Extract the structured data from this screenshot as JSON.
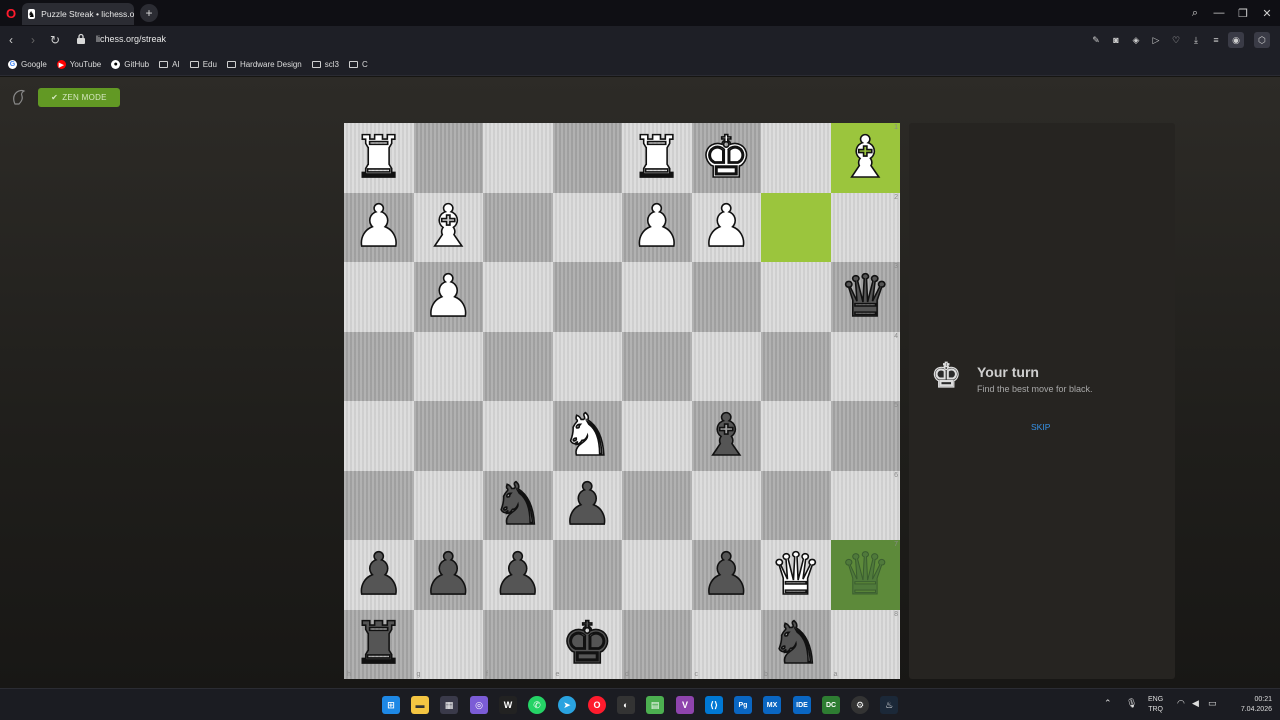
{
  "browser": {
    "tab_title": "Puzzle Streak • lichess.org",
    "url": "lichess.org/streak",
    "bookmarks": [
      "Google",
      "YouTube",
      "GitHub",
      "AI",
      "Edu",
      "Hardware Design",
      "scl3",
      "C"
    ]
  },
  "toolbar": {
    "zen_label": "ZEN MODE"
  },
  "board": {
    "rank_labels": [
      "1",
      "2",
      "3",
      "4",
      "5",
      "6",
      "7",
      "8"
    ],
    "file_labels": [
      "h",
      "g",
      "f",
      "e",
      "d",
      "c",
      "b",
      "a"
    ],
    "rows": [
      [
        "wR",
        "",
        "",
        "",
        "wR",
        "wK",
        "",
        "wB"
      ],
      [
        "wP",
        "wB",
        "",
        "",
        "wP",
        "wP",
        "",
        ""
      ],
      [
        "",
        "wP",
        "",
        "",
        "",
        "",
        "",
        "bQ"
      ],
      [
        "",
        "",
        "",
        "",
        "",
        "",
        "",
        ""
      ],
      [
        "",
        "",
        "",
        "wN",
        "",
        "bB",
        "",
        ""
      ],
      [
        "",
        "",
        "bN",
        "bP",
        "",
        "",
        "",
        ""
      ],
      [
        "bP",
        "bP",
        "bP",
        "",
        "",
        "bP",
        "wQ",
        "gQ"
      ],
      [
        "bR",
        "",
        "",
        "bK",
        "",
        "",
        "bN",
        ""
      ]
    ],
    "highlights": [
      [
        0,
        7
      ],
      [
        1,
        6
      ],
      [
        6,
        7
      ]
    ]
  },
  "panel": {
    "title": "Your turn",
    "subtitle": "Find the best move for black.",
    "skip": "SKIP"
  },
  "taskbar": {
    "lang_top": "ENG",
    "lang_bottom": "TRQ",
    "time": "00:21",
    "date": "7.04.2026"
  }
}
